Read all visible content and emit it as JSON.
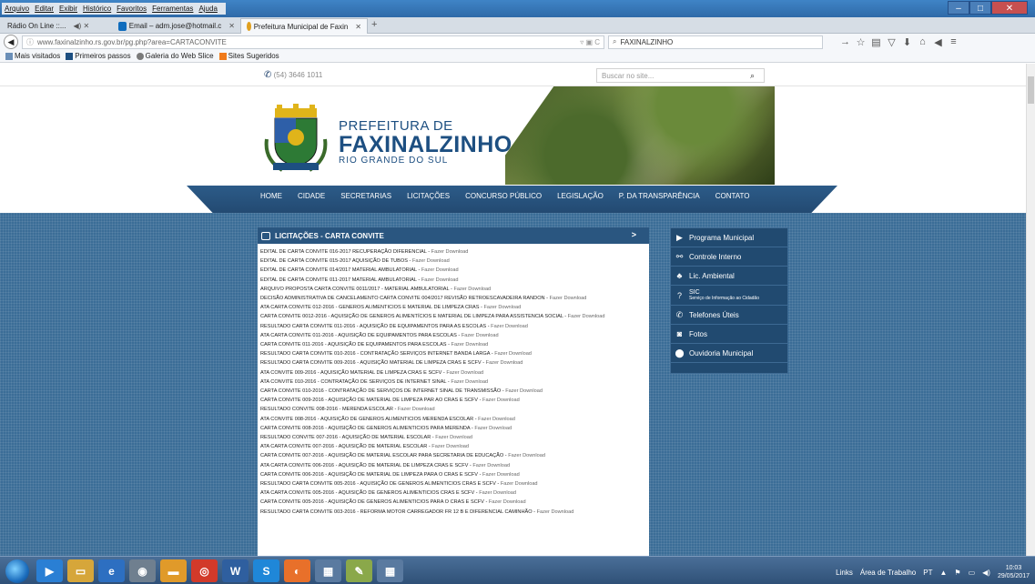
{
  "browser": {
    "menu": [
      "Arquivo",
      "Editar",
      "Exibir",
      "Histórico",
      "Favoritos",
      "Ferramentas",
      "Ajuda"
    ],
    "tabs": [
      {
        "label": "Rádio On Line ::..."
      },
      {
        "label": "Email – adm.jose@hotmail.c"
      },
      {
        "label": "Prefeitura Municipal de Faxin"
      }
    ],
    "url": "www.faxinalzinho.rs.gov.br/pg.php?area=CARTACONVITE",
    "search_value": "FAXINALZINHO",
    "bookmarks": [
      "Mais visitados",
      "Primeiros passos",
      "Galeria do Web Slice",
      "Sites Sugeridos"
    ]
  },
  "site": {
    "phone": "(54) 3646 1011",
    "search_placeholder": "Buscar no site...",
    "brand_line1": "PREFEITURA DE",
    "brand_line2": "FAXINALZINHO",
    "brand_line3": "RIO GRANDE DO SUL",
    "nav": [
      "HOME",
      "CIDADE",
      "SECRETARIAS",
      "LICITAÇÕES",
      "CONCURSO PÚBLICO",
      "LEGISLAÇÃO",
      "P. DA TRANSPARÊNCIA",
      "CONTATO"
    ],
    "section_title": "LICITAÇÕES - CARTA CONVITE",
    "section_arrow": ">",
    "download_label": "Fazer Download",
    "items": [
      "EDITAL DE CARTA CONVITE 016-2017 RECUPERAÇÃO DIFERENCIAL",
      "EDITAL DE CARTA CONVITE 015-2017 AQUISIÇÃO DE TUBOS",
      "EDITAL DE CARTA CONVITE 014/2017 MATERIAL AMBULATORIAL",
      "EDITAL DE CARTA CONVITE 011-2017 MATERIAL AMBULATORIAL",
      "ARQUIVO PROPOSTA CARTA CONVITE 0011/2017 - MATERIAL AMBULATORIAL",
      "DECISÃO ADMINISTRATIVA DE CANCELAMENTO CARTA CONVITE 004/2017 REVISÃO RETROESCAVADEIRA RANDON",
      "ATA CARTA CONVITE 012-2016 - GENEROS ALIMENTICIOS E MATERIAL DE LIMPEZA CRAS",
      "CARTA CONVITE 0012-2016 - AQUISIÇÃO DE GENEROS ALIMENTÍCIOS E MATERIAL DE LIMPEZA PARA ASSISTENCIA SOCIAL",
      "RESULTADO CARTA CONVITE 011-2016 - AQUISIÇÃO DE EQUIPAMENTOS PARA AS ESCOLAS",
      "ATA CARTA CONVITE 011-2016 - AQUISIÇÃO DE EQUIPAMENTOS PARA ESCOLAS",
      "CARTA CONVITE 011-2016 - AQUISIÇÃO DE EQUIPAMENTOS PARA ESCOLAS",
      "RESULTADO CARTA CONVITE 010-2016 - CONTRATAÇÃO SERVIÇOS INTERNET BANDA LARGA",
      "RESULTADO CARTA CONVITE 009-2016 - AQUISIÇÃO MATERIAL DE LIMPEZA CRAS E SCFV",
      "ATA CONVITE 009-2016 - AQUISIÇÃO MATERIAL DE LIMPEZA CRAS E SCFV",
      "ATA CONVITE 010-2016 - CONTRATAÇÃO DE SERVIÇOS DE INTERNET SINAL",
      "CARTA CONVITE 010-2016 - CONTRATAÇÃO DE SERVIÇOS DE INTERNET SINAL DE TRANSMISSÃO",
      "CARTA CONVITE 009-2016 - AQUISIÇÃO DE MATERIAL DE LIMPEZA PAR AO CRAS E SCFV",
      "RESULTADO CONVITE 008-2016 - MERENDA ESCOLAR",
      "ATA CONVITE 008-2016 - AQUISIÇÃO DE GENEROS ALIMENTICIOS MERENDA ESCOLAR",
      "CARTA CONVITE 008-2016 - AQUISIÇÃO DE GENEROS ALIMENTICIOS PARA MERENDA",
      "RESULTADO CONVITE 007-2016 - AQUISIÇÃO DE MATERIAL ESCOLAR",
      "ATA CARTA CONVITE 007-2016 - AQUISIÇÃO DE MATERIAL ESCOLAR",
      "CARTA CONVITE 007-2016 - AQUISIÇÃO DE MATERIAL ESCOLAR PARA SECRETARIA DE EDUCAÇÃO",
      "ATA CARTA CONVITE 006-2016 - AQUISIÇÃO DE MATERIAL DE LIMPEZA CRAS E SCFV",
      "CARTA CONVITE 006-2016 - AQUISIÇÃO DE MATERIAL DE LIMPEZA PARA O CRAS E SCFV",
      "RESULTADO CARTA CONVITE 005-2016 - AQUISIÇÃO DE GENEROS ALIMENTICIOS CRAS E SCFV",
      "ATA CARTA CONVITE 005-2016 - AQUISIÇÃO DE GENEROS ALIMENTICIOS CRAS E SCFV",
      "CARTA CONVITE 005-2016 - AQUISIÇÃO DE GENEROS ALIMENTICIOS PARA O CRAS E SCFV",
      "RESULTADO CARTA CONVITE 003-2016 - REFORMA MOTOR CARREGADOR FR 12 B E DIFERENCIAL CAMINHÃO"
    ],
    "sidebar": [
      {
        "label": "Programa Municipal",
        "icon": "arrow-right-icon"
      },
      {
        "label": "Controle Interno",
        "icon": "link-icon"
      },
      {
        "label": "Lic. Ambiental",
        "icon": "tree-icon"
      },
      {
        "label": "SIC",
        "sub": "Serviço de Informação ao Cidadão",
        "icon": "question-icon"
      },
      {
        "label": "Telefones Úteis",
        "icon": "phone-icon"
      },
      {
        "label": "Fotos",
        "icon": "camera-icon"
      },
      {
        "label": "Ouvidoria Municipal",
        "icon": "pin-icon"
      }
    ]
  },
  "taskbar": {
    "links": "Links",
    "desktop": "Área de Trabalho",
    "lang": "PT",
    "time": "10:03",
    "date": "29/05/2017"
  },
  "colors": {
    "nav_blue": "#2c5b88",
    "brand_blue": "#1d4f81",
    "body_blue": "#3b6d97"
  }
}
